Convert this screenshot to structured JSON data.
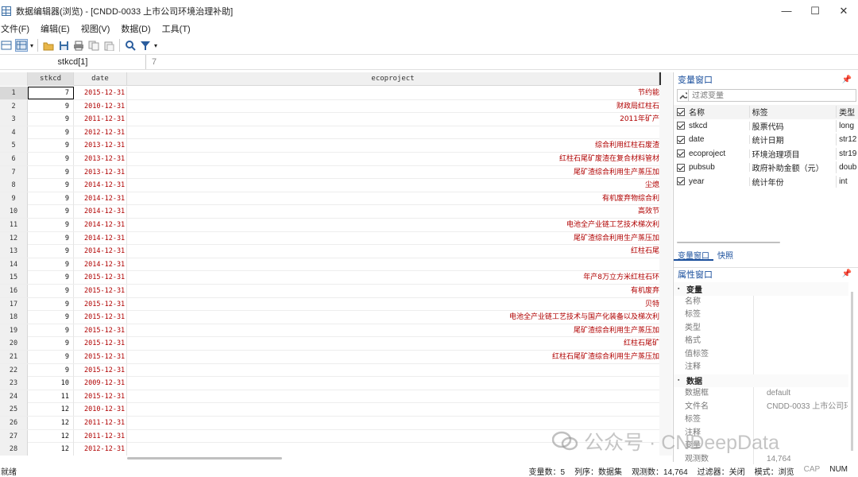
{
  "window": {
    "title": "数据编辑器(浏览) - [CNDD-0033 上市公司环境治理补助]",
    "minimize": "—",
    "maximize": "☐",
    "close": "✕"
  },
  "menu": [
    "文件(F)",
    "编辑(E)",
    "视图(V)",
    "数据(D)",
    "工具(T)"
  ],
  "cellbar": {
    "name": "stkcd[1]",
    "value": "7"
  },
  "grid": {
    "columns": [
      "stkcd",
      "date",
      "ecoproject"
    ],
    "rows": [
      {
        "n": "1",
        "stkcd": "7",
        "date": "2015-12-31",
        "eco": "节约能"
      },
      {
        "n": "2",
        "stkcd": "9",
        "date": "2010-12-31",
        "eco": "财政局红柱石"
      },
      {
        "n": "3",
        "stkcd": "9",
        "date": "2011-12-31",
        "eco": "2011年矿产"
      },
      {
        "n": "4",
        "stkcd": "9",
        "date": "2012-12-31",
        "eco": ""
      },
      {
        "n": "5",
        "stkcd": "9",
        "date": "2013-12-31",
        "eco": "综合利用红柱石废渣"
      },
      {
        "n": "6",
        "stkcd": "9",
        "date": "2013-12-31",
        "eco": "红柱石尾矿废渣在复合材料管材"
      },
      {
        "n": "7",
        "stkcd": "9",
        "date": "2013-12-31",
        "eco": "尾矿渣综合利用生产蒸压加"
      },
      {
        "n": "8",
        "stkcd": "9",
        "date": "2014-12-31",
        "eco": "尘熄"
      },
      {
        "n": "9",
        "stkcd": "9",
        "date": "2014-12-31",
        "eco": "有机废弃物综合利"
      },
      {
        "n": "10",
        "stkcd": "9",
        "date": "2014-12-31",
        "eco": "高效节"
      },
      {
        "n": "11",
        "stkcd": "9",
        "date": "2014-12-31",
        "eco": "电池全产业链工艺技术梯次利"
      },
      {
        "n": "12",
        "stkcd": "9",
        "date": "2014-12-31",
        "eco": "尾矿渣综合利用生产蒸压加"
      },
      {
        "n": "13",
        "stkcd": "9",
        "date": "2014-12-31",
        "eco": "红柱石尾"
      },
      {
        "n": "14",
        "stkcd": "9",
        "date": "2014-12-31",
        "eco": ""
      },
      {
        "n": "15",
        "stkcd": "9",
        "date": "2015-12-31",
        "eco": "年产8万立方米红柱石环"
      },
      {
        "n": "16",
        "stkcd": "9",
        "date": "2015-12-31",
        "eco": "有机废弃"
      },
      {
        "n": "17",
        "stkcd": "9",
        "date": "2015-12-31",
        "eco": "贝特"
      },
      {
        "n": "18",
        "stkcd": "9",
        "date": "2015-12-31",
        "eco": "电池全产业链工艺技术与国产化装备以及梯次利"
      },
      {
        "n": "19",
        "stkcd": "9",
        "date": "2015-12-31",
        "eco": "尾矿渣综合利用生产蒸压加"
      },
      {
        "n": "20",
        "stkcd": "9",
        "date": "2015-12-31",
        "eco": "红柱石尾矿"
      },
      {
        "n": "21",
        "stkcd": "9",
        "date": "2015-12-31",
        "eco": "红柱石尾矿渣综合利用生产蒸压加"
      },
      {
        "n": "22",
        "stkcd": "9",
        "date": "2015-12-31",
        "eco": ""
      },
      {
        "n": "23",
        "stkcd": "10",
        "date": "2009-12-31",
        "eco": ""
      },
      {
        "n": "24",
        "stkcd": "11",
        "date": "2015-12-31",
        "eco": ""
      },
      {
        "n": "25",
        "stkcd": "12",
        "date": "2010-12-31",
        "eco": ""
      },
      {
        "n": "26",
        "stkcd": "12",
        "date": "2011-12-31",
        "eco": ""
      },
      {
        "n": "27",
        "stkcd": "12",
        "date": "2011-12-31",
        "eco": ""
      },
      {
        "n": "28",
        "stkcd": "12",
        "date": "2012-12-31",
        "eco": ""
      }
    ]
  },
  "variables_panel": {
    "title": "变量窗口",
    "filter_placeholder": "过滤变量",
    "headers": {
      "name": "名称",
      "label": "标签",
      "type": "类型"
    },
    "vars": [
      {
        "name": "stkcd",
        "label": "股票代码",
        "type": "long"
      },
      {
        "name": "date",
        "label": "统计日期",
        "type": "str12"
      },
      {
        "name": "ecoproject",
        "label": "环境治理项目",
        "type": "str19"
      },
      {
        "name": "pubsub",
        "label": "政府补助金额（元）",
        "type": "doub"
      },
      {
        "name": "year",
        "label": "统计年份",
        "type": "int"
      }
    ],
    "tabs": [
      "变量窗口",
      "快照"
    ]
  },
  "properties_panel": {
    "title": "属性窗口",
    "rows": [
      {
        "kind": "section",
        "k": "变量",
        "v": ""
      },
      {
        "kind": "row",
        "k": "名称",
        "v": ""
      },
      {
        "kind": "row",
        "k": "标签",
        "v": ""
      },
      {
        "kind": "row",
        "k": "类型",
        "v": ""
      },
      {
        "kind": "row",
        "k": "格式",
        "v": ""
      },
      {
        "kind": "row",
        "k": "值标签",
        "v": ""
      },
      {
        "kind": "row",
        "k": "注释",
        "v": ""
      },
      {
        "kind": "section",
        "k": "数据",
        "v": ""
      },
      {
        "kind": "row",
        "k": "数据框",
        "v": "default"
      },
      {
        "kind": "row",
        "k": "文件名",
        "v": "CNDD-0033 上市公司环"
      },
      {
        "kind": "row",
        "k": "标签",
        "v": ""
      },
      {
        "kind": "row",
        "k": "注释",
        "v": ""
      },
      {
        "kind": "row",
        "k": "变量",
        "v": ""
      },
      {
        "kind": "row",
        "k": "观测数",
        "v": "14,764"
      }
    ]
  },
  "status": {
    "ready": "就绪",
    "varcount": "变量数：5",
    "order": "列序：数据集",
    "obs": "观测数：14,764",
    "filter": "过滤器：关闭",
    "mode": "模式：浏览",
    "cap": "CAP",
    "num": "NUM"
  },
  "watermark": "公众号 · CNDeepData"
}
